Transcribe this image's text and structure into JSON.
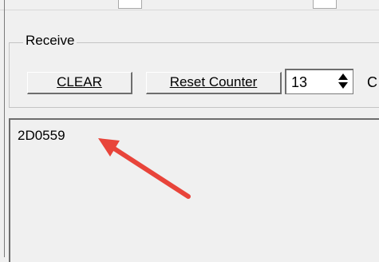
{
  "receive_group": {
    "title": "Receive",
    "clear_button": "CLEAR",
    "reset_counter_button": "Reset Counter",
    "counter_value": "13",
    "trailing_char": "C"
  },
  "receive_area": {
    "text": "2D0559"
  },
  "annotation": {
    "arrow_color": "#e8443a"
  }
}
